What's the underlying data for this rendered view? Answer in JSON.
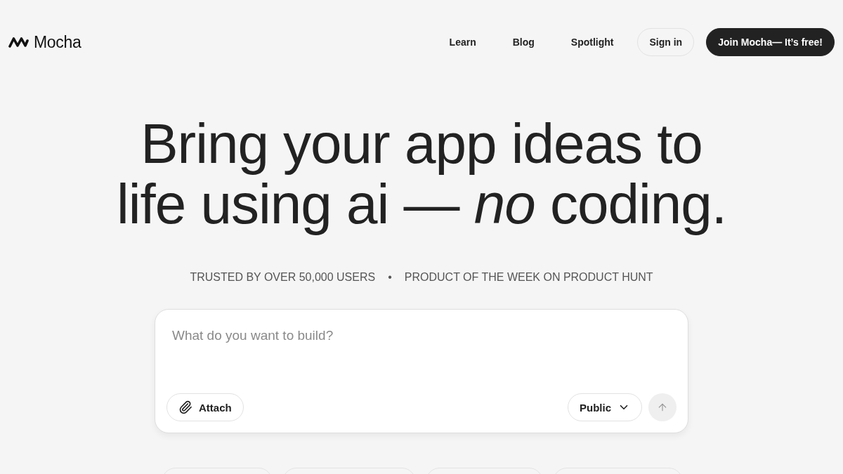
{
  "header": {
    "logo": "Mocha",
    "nav_links": [
      "Learn",
      "Blog",
      "Spotlight"
    ],
    "sign_in": "Sign in",
    "cta": "Join Mocha— It’s free!"
  },
  "hero": {
    "headline": [
      "Bring your app ideas to",
      "life using ai — *no* coding."
    ],
    "badges": [
      "TRUSTED BY OVER 50,000 USERS",
      "PRODUCT OF THE WEEK ON PRODUCT HUNT"
    ],
    "separator": "•"
  },
  "prompt": {
    "placeholder": "What do you want to build?",
    "attach": "Attach",
    "visibility": "Public",
    "send_disabled": true
  }
}
